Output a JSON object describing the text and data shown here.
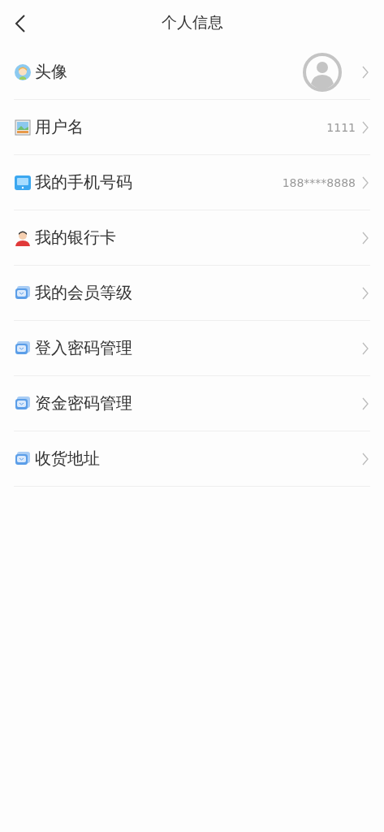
{
  "header": {
    "title": "个人信息"
  },
  "items": [
    {
      "kind": "avatar",
      "label": "头像"
    },
    {
      "kind": "username",
      "label": "用户名",
      "value": "1111"
    },
    {
      "kind": "phone",
      "label": "我的手机号码",
      "value": "188****8888"
    },
    {
      "kind": "card",
      "label": "我的银行卡"
    },
    {
      "kind": "entry",
      "label": "我的会员等级"
    },
    {
      "kind": "entry",
      "label": "登入密码管理"
    },
    {
      "kind": "entry",
      "label": "资金密码管理"
    },
    {
      "kind": "entry",
      "label": "收货地址"
    }
  ]
}
